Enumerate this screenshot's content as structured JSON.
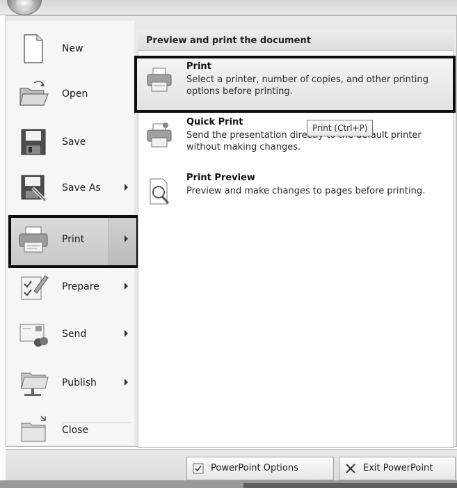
{
  "panel": {
    "header": "Preview and print the document"
  },
  "left_menu": [
    {
      "label": "New",
      "icon": "new-document-icon",
      "has_submenu": false
    },
    {
      "label": "Open",
      "icon": "open-folder-icon",
      "has_submenu": false
    },
    {
      "label": "Save",
      "icon": "save-disk-icon",
      "has_submenu": false
    },
    {
      "label": "Save As",
      "icon": "save-as-icon",
      "has_submenu": true
    },
    {
      "label": "Print",
      "icon": "printer-icon",
      "has_submenu": true,
      "selected": true
    },
    {
      "label": "Prepare",
      "icon": "prepare-icon",
      "has_submenu": true
    },
    {
      "label": "Send",
      "icon": "send-icon",
      "has_submenu": true
    },
    {
      "label": "Publish",
      "icon": "publish-icon",
      "has_submenu": true
    },
    {
      "label": "Close",
      "icon": "close-folder-icon",
      "has_submenu": false
    }
  ],
  "print_options": [
    {
      "title": "Print",
      "description": "Select a printer, number of copies, and other printing options before printing.",
      "icon": "printer-icon",
      "highlighted": true
    },
    {
      "title": "Quick Print",
      "description": "Send the presentation directly to the default printer without making changes.",
      "icon": "quick-print-icon"
    },
    {
      "title": "Print Preview",
      "description": "Preview and make changes to pages before printing.",
      "icon": "print-preview-icon"
    }
  ],
  "tooltip": "Print (Ctrl+P)",
  "bottom_buttons": [
    {
      "label": "PowerPoint Options",
      "icon": "options-icon"
    },
    {
      "label": "Exit PowerPoint",
      "icon": "exit-x-icon"
    }
  ],
  "colors": {
    "highlight_border": "#0d0d0d",
    "panel_background": "#ffffff",
    "menu_background": "#f6f6f6"
  }
}
